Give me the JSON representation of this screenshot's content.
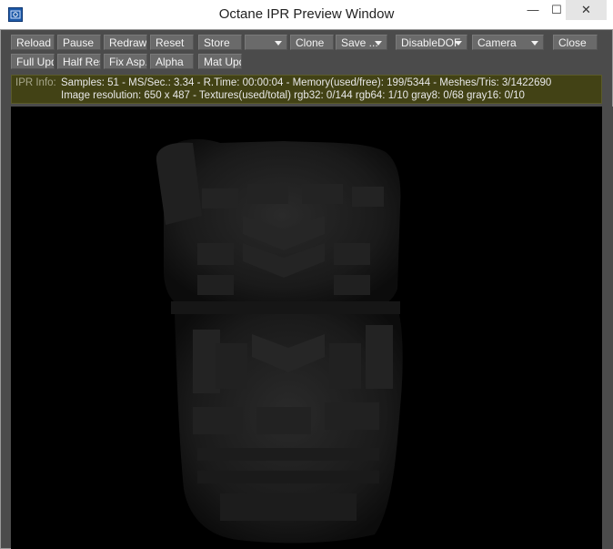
{
  "window": {
    "title": "Octane IPR Preview Window",
    "controls": [
      "—",
      "☐",
      "✕"
    ]
  },
  "toolbar": {
    "row1": [
      {
        "label": "Reload",
        "dropdown": false
      },
      {
        "label": "Pause",
        "dropdown": false
      },
      {
        "label": "Redraw",
        "dropdown": false
      },
      {
        "label": "Reset",
        "dropdown": false
      },
      {
        "label": "Store",
        "dropdown": false
      },
      {
        "label": "",
        "dropdown": true
      },
      {
        "label": "Clone",
        "dropdown": false
      },
      {
        "label": "Save ...",
        "dropdown": true
      },
      {
        "label": "DisableDOF",
        "dropdown": true
      },
      {
        "label": "Camera",
        "dropdown": true
      },
      {
        "label": "Close",
        "dropdown": false
      }
    ],
    "row2": [
      {
        "label": "Full Upd.",
        "dropdown": false
      },
      {
        "label": "Half Res",
        "dropdown": false
      },
      {
        "label": "Fix Asp.",
        "dropdown": false
      },
      {
        "label": "Alpha",
        "dropdown": false
      },
      {
        "label": "Mat Upd",
        "dropdown": false
      }
    ]
  },
  "info": {
    "label": "IPR Info:",
    "line1": "Samples: 51  -  MS/Sec.: 3.34  -  R.Time: 00:00:04 - Memory(used/free): 199/5344  -  Meshes/Tris: 3/1422690",
    "line2": "Image resolution: 650 x 487 - Textures(used/total) rgb32: 0/144  rgb64: 1/10  gray8: 0/68  gray16: 0/10"
  },
  "colors": {
    "frame": "#4b4b4b",
    "button": "#6a6a6a",
    "info_bg": "#424215",
    "viewport": "#000000"
  }
}
